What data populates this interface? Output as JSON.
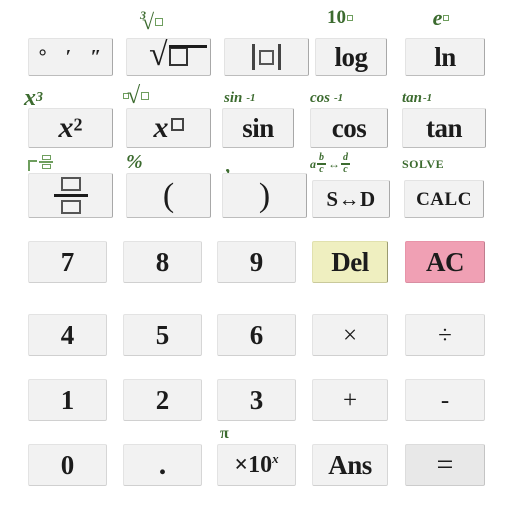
{
  "app": {
    "name": "scientific-calculator-keypad",
    "background": "#ffffff",
    "key_background": "#f2f2f2",
    "shift_label_color": "#3c6b2f",
    "del_color": "#efefc0",
    "ac_color": "#f0a0b4"
  },
  "function_rows": [
    {
      "row": 1,
      "keys": [
        {
          "id": "degrees",
          "label": "° ′ ″",
          "shift": "",
          "shift_align": "left"
        },
        {
          "id": "sqrt",
          "label": "√□",
          "shift": "³√□",
          "shift_align": "center"
        },
        {
          "id": "abs",
          "label": "|□|",
          "shift": "",
          "shift_align": "center"
        },
        {
          "id": "log",
          "label": "log",
          "shift": "10□",
          "shift_align": "center"
        },
        {
          "id": "ln",
          "label": "ln",
          "shift": "e□",
          "shift_align": "center"
        }
      ]
    },
    {
      "row": 2,
      "keys": [
        {
          "id": "x-squared",
          "label": "x²",
          "shift": "x³",
          "shift_align": "left"
        },
        {
          "id": "x-power",
          "label": "x□",
          "shift": "□√□",
          "shift_align": "left"
        },
        {
          "id": "sin",
          "label": "sin",
          "shift": "sin⁻¹",
          "shift_align": "left"
        },
        {
          "id": "cos",
          "label": "cos",
          "shift": "cos⁻¹",
          "shift_align": "left"
        },
        {
          "id": "tan",
          "label": "tan",
          "shift": "tan⁻¹",
          "shift_align": "left"
        }
      ]
    },
    {
      "row": 3,
      "keys": [
        {
          "id": "fraction",
          "label": "□/□",
          "shift": "□ □/□",
          "shift_align": "left"
        },
        {
          "id": "open-paren",
          "label": "(",
          "shift": "%",
          "shift_align": "left"
        },
        {
          "id": "close-paren",
          "label": ")",
          "shift": ",",
          "shift_align": "left"
        },
        {
          "id": "s-to-d",
          "label": "S↔D",
          "shift": "a b/c ↔ d/c",
          "shift_align": "left"
        },
        {
          "id": "calc",
          "label": "CALC",
          "shift": "SOLVE",
          "shift_align": "left"
        }
      ]
    }
  ],
  "numeric_rows": [
    {
      "row": 1,
      "keys": [
        {
          "id": "seven",
          "label": "7",
          "style": "plain",
          "shift": ""
        },
        {
          "id": "eight",
          "label": "8",
          "style": "plain",
          "shift": ""
        },
        {
          "id": "nine",
          "label": "9",
          "style": "plain",
          "shift": ""
        },
        {
          "id": "del",
          "label": "Del",
          "style": "del",
          "shift": ""
        },
        {
          "id": "ac",
          "label": "AC",
          "style": "ac",
          "shift": ""
        }
      ]
    },
    {
      "row": 2,
      "keys": [
        {
          "id": "four",
          "label": "4",
          "style": "plain",
          "shift": ""
        },
        {
          "id": "five",
          "label": "5",
          "style": "plain",
          "shift": ""
        },
        {
          "id": "six",
          "label": "6",
          "style": "plain",
          "shift": ""
        },
        {
          "id": "multiply",
          "label": "×",
          "style": "op",
          "shift": ""
        },
        {
          "id": "divide",
          "label": "÷",
          "style": "op",
          "shift": ""
        }
      ]
    },
    {
      "row": 3,
      "keys": [
        {
          "id": "one",
          "label": "1",
          "style": "plain",
          "shift": ""
        },
        {
          "id": "two",
          "label": "2",
          "style": "plain",
          "shift": ""
        },
        {
          "id": "three",
          "label": "3",
          "style": "plain",
          "shift": ""
        },
        {
          "id": "plus",
          "label": "+",
          "style": "op",
          "shift": ""
        },
        {
          "id": "minus",
          "label": "-",
          "style": "op",
          "shift": ""
        }
      ]
    },
    {
      "row": 4,
      "keys": [
        {
          "id": "zero",
          "label": "0",
          "style": "plain",
          "shift": ""
        },
        {
          "id": "decimal-point",
          "label": ".",
          "style": "dot",
          "shift": ""
        },
        {
          "id": "times-ten-power",
          "label": "×10ˣ",
          "style": "exp",
          "shift": "π"
        },
        {
          "id": "ans",
          "label": "Ans",
          "style": "word",
          "shift": ""
        },
        {
          "id": "equals",
          "label": "=",
          "style": "eq",
          "shift": ""
        }
      ]
    }
  ]
}
